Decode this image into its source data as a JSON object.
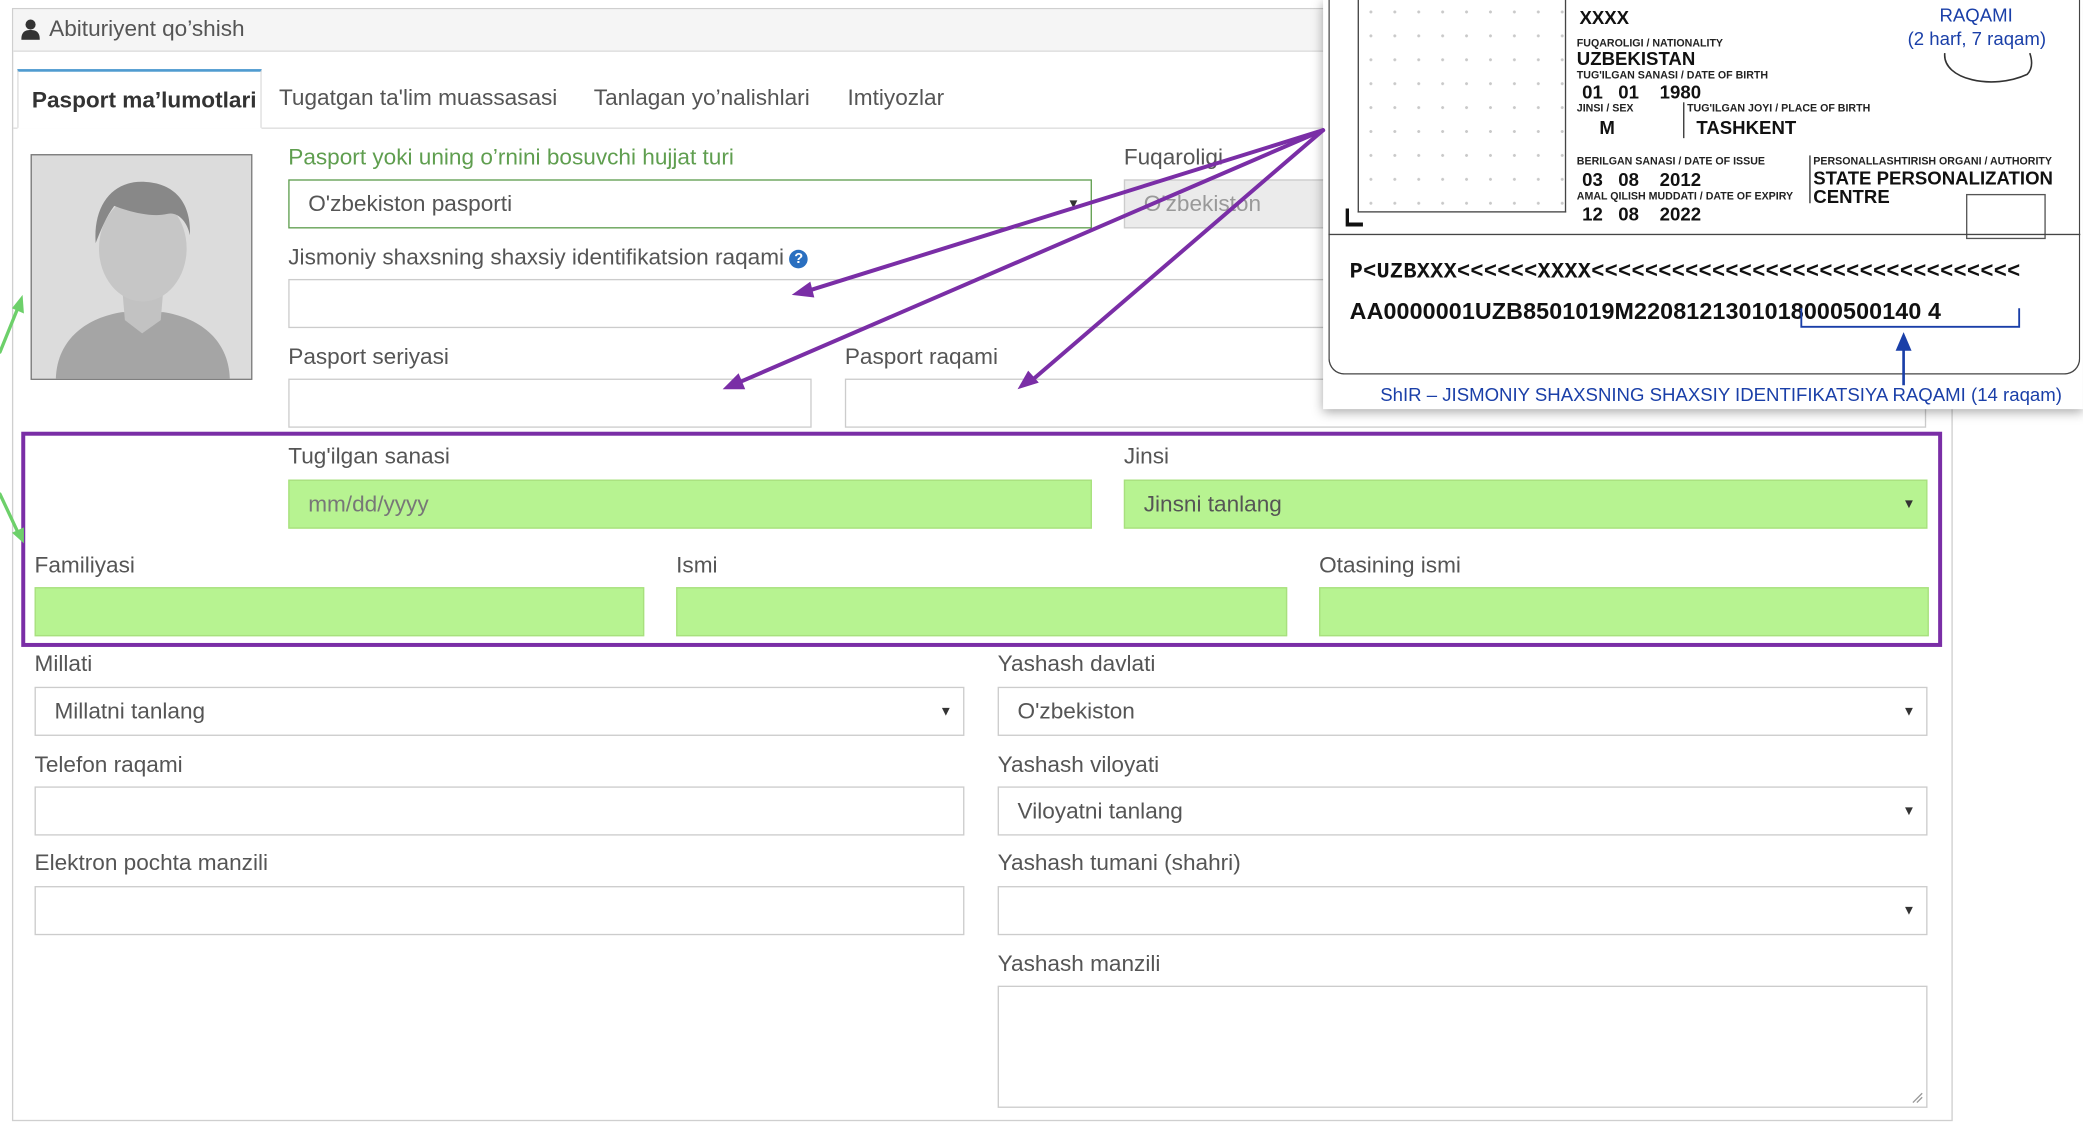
{
  "panel": {
    "title": "Abituriyent qo’shish"
  },
  "tabs": [
    {
      "label": "Pasport ma’lumotlari"
    },
    {
      "label": "Tugatgan ta'lim muassasasi"
    },
    {
      "label": "Tanlagan yo’nalishlari"
    },
    {
      "label": "Imtiyozlar"
    }
  ],
  "form": {
    "doc_type": {
      "label": "Pasport yoki uning o’rnini bosuvchi hujjat turi",
      "value": "O'zbekiston pasporti"
    },
    "citizenship": {
      "label": "Fuqaroligi",
      "value": "O'zbekiston"
    },
    "pinfl": {
      "label": "Jismoniy shaxsning shaxsiy identifikatsion raqami",
      "value": ""
    },
    "passport_series": {
      "label": "Pasport seriyasi",
      "value": ""
    },
    "passport_number": {
      "label": "Pasport raqami",
      "value": ""
    },
    "birth_date": {
      "label": "Tug'ilgan sanasi",
      "placeholder": "mm/dd/yyyy"
    },
    "gender": {
      "label": "Jinsi",
      "value": "Jinsni tanlang"
    },
    "surname": {
      "label": "Familiyasi",
      "value": ""
    },
    "name": {
      "label": "Ismi",
      "value": ""
    },
    "patronymic": {
      "label": "Otasining ismi",
      "value": ""
    },
    "nationality": {
      "label": "Millati",
      "value": "Millatni tanlang"
    },
    "country": {
      "label": "Yashash davlati",
      "value": "O'zbekiston"
    },
    "phone": {
      "label": "Telefon raqami",
      "value": ""
    },
    "region": {
      "label": "Yashash viloyati",
      "value": "Viloyatni tanlang"
    },
    "email": {
      "label": "Elektron pochta manzili",
      "value": ""
    },
    "district": {
      "label": "Yashash tumani (shahri)",
      "value": ""
    },
    "address": {
      "label": "Yashash manzili",
      "value": ""
    }
  },
  "passport_card": {
    "surname_value": "XXXX",
    "nationality_label": "FUQAROLIGI / NATIONALITY",
    "nationality_value": "UZBEKISTAN",
    "dob_label": "TUG'ILGAN SANASI / DATE OF BIRTH",
    "dob_value": "01   01    1980",
    "sex_label": "JINSI / SEX",
    "sex_value": "M",
    "pob_label": "TUG'ILGAN JOYI / PLACE OF BIRTH",
    "pob_value": "TASHKENT",
    "issue_label": "BERILGAN SANASI / DATE OF ISSUE",
    "issue_value": "03   08    2012",
    "expiry_label": "AMAL QILISH MUDDATI / DATE OF EXPIRY",
    "expiry_value": "12   08    2022",
    "authority_label": "PERSONALLASHTIRISH ORGANI / AUTHORITY",
    "authority_line1": "STATE PERSONALIZATION",
    "authority_line2": "CENTRE",
    "raqami": "RAQAMI",
    "raqami_note": "(2 harf, 7 raqam)",
    "mrz_line1": "P<UZBXXX<<<<<<XXXX<<<<<<<<<<<<<<<<<<<<<<<<<<<<<<<<",
    "mrz_line2": "AA0000001UZB8501019M2208121301018000500140 4",
    "pinfl_caption": "ShIR – JISMONIY SHAXSNING SHAXSIY IDENTIFIKATSIYA RAQAMI (14 raqam)"
  },
  "colors": {
    "highlight_border": "#7a2ea6",
    "field_green": "#b7f391",
    "tab_accent": "#4f9bd0",
    "annotation_blue": "#1a3fa8",
    "arrow_green": "#6dd06a"
  }
}
